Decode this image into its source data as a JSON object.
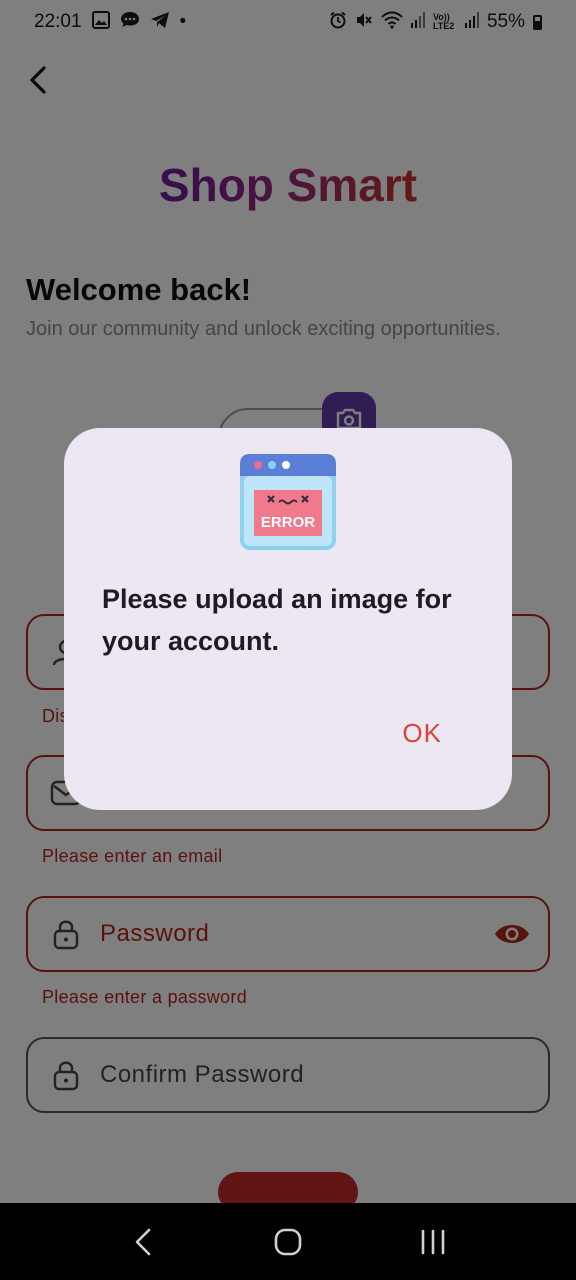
{
  "status_bar": {
    "time": "22:01",
    "dot": "•",
    "battery_text": "55%",
    "icons_left": [
      "gallery-icon",
      "chat-icon",
      "telegram-icon"
    ],
    "icons_right": [
      "alarm-icon",
      "mute-icon",
      "wifi-icon",
      "signal-icon",
      "volte-icon",
      "signal-icon"
    ],
    "volte_text": "Vo)) LTE2"
  },
  "header": {
    "back_icon": "back-arrow-icon",
    "app_title": "Shop Smart"
  },
  "form": {
    "welcome": "Welcome back!",
    "subtitle": "Join our community and unlock exciting opportunities.",
    "username_error_partial": "Dis",
    "email_error": "Please enter an email",
    "password_label": "Password",
    "password_error": "Please enter a password",
    "confirm_password_label": "Confirm Password"
  },
  "dialog": {
    "icon": "error-window-icon",
    "icon_text": "ERROR",
    "message": "Please upload an image for your account.",
    "ok_label": "OK"
  },
  "colors": {
    "accent_purple": "#6c1b9e",
    "accent_red": "#c8312c",
    "error": "#b3261e",
    "dialog_bg": "#ede6f3",
    "ok": "#d7463a"
  }
}
